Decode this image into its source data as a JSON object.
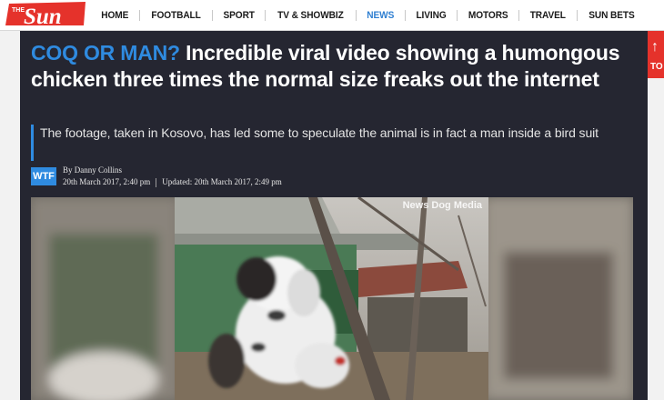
{
  "nav": {
    "logo": {
      "small": "THE",
      "big": "Sun"
    },
    "items": [
      {
        "label": "HOME",
        "active": false
      },
      {
        "label": "FOOTBALL",
        "active": false
      },
      {
        "label": "SPORT",
        "active": false
      },
      {
        "label": "TV & SHOWBIZ",
        "active": false
      },
      {
        "label": "NEWS",
        "active": true
      },
      {
        "label": "LIVING",
        "active": false
      },
      {
        "label": "MOTORS",
        "active": false
      },
      {
        "label": "TRAVEL",
        "active": false
      },
      {
        "label": "SUN BETS",
        "active": false
      }
    ]
  },
  "side_button": {
    "label": "TO"
  },
  "article": {
    "kicker": "COQ OR MAN?",
    "headline": " Incredible viral video showing a humongous chicken three times the normal size freaks out the internet",
    "standfirst": "The footage, taken in Kosovo, has led some to speculate the animal is in fact a man inside a bird suit",
    "badge": "WTF",
    "byline": "By Danny Collins",
    "published": "20th March 2017, 2:40 pm",
    "updated": "Updated: 20th March 2017, 2:49 pm"
  },
  "video": {
    "watermark": "News Dog Media"
  },
  "colors": {
    "accent_blue": "#2f8be0",
    "brand_red": "#e5322b",
    "dark_bg": "#252631"
  }
}
